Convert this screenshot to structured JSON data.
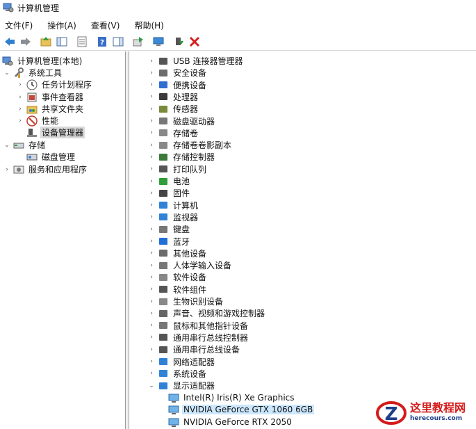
{
  "window": {
    "title": "计算机管理"
  },
  "menu": [
    "文件(F)",
    "操作(A)",
    "查看(V)",
    "帮助(H)"
  ],
  "toolbar": [
    "back-icon",
    "forward-icon",
    "up-folder-icon",
    "show-hide-tree-icon",
    "properties-icon",
    "help-icon",
    "show-action-pane-icon",
    "export-list-icon",
    "monitor-icon",
    "enable-device-icon",
    "delete-icon"
  ],
  "left_tree": {
    "root": "计算机管理(本地)",
    "system_tools": "系统工具",
    "task_scheduler": "任务计划程序",
    "event_viewer": "事件查看器",
    "shared_folders": "共享文件夹",
    "performance": "性能",
    "device_manager": "设备管理器",
    "storage": "存储",
    "disk_management": "磁盘管理",
    "services_apps": "服务和应用程序"
  },
  "devices": [
    {
      "label": "USB 连接器管理器",
      "icon": "usb-connector-icon"
    },
    {
      "label": "安全设备",
      "icon": "security-device-icon"
    },
    {
      "label": "便携设备",
      "icon": "portable-device-icon"
    },
    {
      "label": "处理器",
      "icon": "processor-icon"
    },
    {
      "label": "传感器",
      "icon": "sensor-icon"
    },
    {
      "label": "磁盘驱动器",
      "icon": "disk-drive-icon"
    },
    {
      "label": "存储卷",
      "icon": "storage-volume-icon"
    },
    {
      "label": "存储卷卷影副本",
      "icon": "shadow-copy-icon"
    },
    {
      "label": "存储控制器",
      "icon": "storage-controller-icon"
    },
    {
      "label": "打印队列",
      "icon": "print-queue-icon"
    },
    {
      "label": "电池",
      "icon": "battery-icon"
    },
    {
      "label": "固件",
      "icon": "firmware-icon"
    },
    {
      "label": "计算机",
      "icon": "computer-icon"
    },
    {
      "label": "监视器",
      "icon": "monitor-icon"
    },
    {
      "label": "键盘",
      "icon": "keyboard-icon"
    },
    {
      "label": "蓝牙",
      "icon": "bluetooth-icon"
    },
    {
      "label": "其他设备",
      "icon": "other-devices-icon"
    },
    {
      "label": "人体学输入设备",
      "icon": "hid-icon"
    },
    {
      "label": "软件设备",
      "icon": "software-device-icon"
    },
    {
      "label": "软件组件",
      "icon": "software-component-icon"
    },
    {
      "label": "生物识别设备",
      "icon": "biometric-icon"
    },
    {
      "label": "声音、视频和游戏控制器",
      "icon": "sound-icon"
    },
    {
      "label": "鼠标和其他指针设备",
      "icon": "mouse-icon"
    },
    {
      "label": "通用串行总线控制器",
      "icon": "usb-controller-icon"
    },
    {
      "label": "通用串行总线设备",
      "icon": "usb-device-icon"
    },
    {
      "label": "网络适配器",
      "icon": "network-adapter-icon"
    },
    {
      "label": "系统设备",
      "icon": "system-device-icon"
    },
    {
      "label": "显示适配器",
      "icon": "display-adapter-icon",
      "expanded": true
    }
  ],
  "display_adapters": [
    {
      "label": "Intel(R) Iris(R) Xe Graphics",
      "highlighted": false
    },
    {
      "label": "NVIDIA GeForce GTX 1060 6GB",
      "highlighted": true
    },
    {
      "label": "NVIDIA GeForce RTX 2050",
      "highlighted": false
    }
  ],
  "watermark": {
    "title": "这里教程网",
    "url": "herecours.com"
  },
  "colors": {
    "selection": "#d9d9d9",
    "highlight": "#cce8ff",
    "watermark_red": "#d31b1b",
    "watermark_blue": "#1e3f8a"
  }
}
